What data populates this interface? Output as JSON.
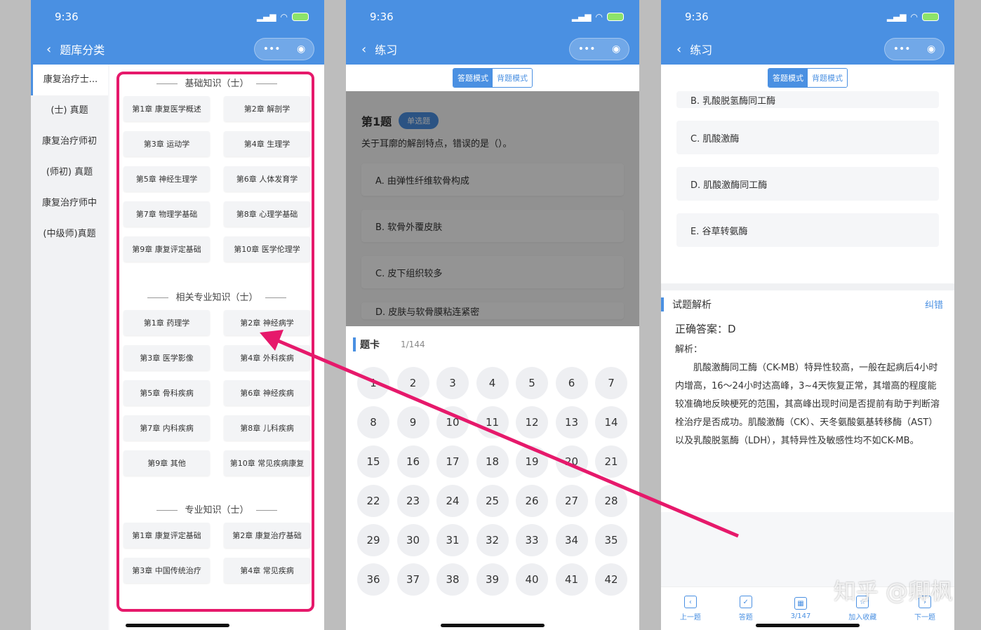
{
  "status": {
    "time": "9:36"
  },
  "phone1": {
    "nav_title": "题库分类",
    "sidebar": [
      "康复治疗士...",
      "(士) 真题",
      "康复治疗师初",
      "(师初) 真题",
      "康复治疗师中",
      "(中级师)真题"
    ],
    "sections": [
      {
        "title": "基础知识（士）",
        "chapters": [
          "第1章 康复医学概述",
          "第2章 解剖学",
          "第3章 运动学",
          "第4章 生理学",
          "第5章 神经生理学",
          "第6章 人体发育学",
          "第7章 物理学基础",
          "第8章 心理学基础",
          "第9章 康复评定基础",
          "第10章 医学伦理学"
        ]
      },
      {
        "title": "相关专业知识（士）",
        "chapters": [
          "第1章 药理学",
          "第2章 神经病学",
          "第3章 医学影像",
          "第4章 外科疾病",
          "第5章 骨科疾病",
          "第6章 神经疾病",
          "第7章 内科疾病",
          "第8章 儿科疾病",
          "第9章 其他",
          "第10章 常见疾病康复"
        ]
      },
      {
        "title": "专业知识（士）",
        "chapters": [
          "第1章 康复评定基础",
          "第2章 康复治疗基础",
          "第3章 中国传统治疗",
          "第4章 常见疾病"
        ]
      }
    ]
  },
  "phone2": {
    "nav_title": "练习",
    "mode_answer": "答题模式",
    "mode_recite": "背题模式",
    "question_no": "第1题",
    "question_type": "单选题",
    "question_text": "关于耳廓的解剖特点，错误的是（）。",
    "options": [
      "A. 由弹性纤维软骨构成",
      "B. 软骨外覆皮肤",
      "C. 皮下组织较多",
      "D. 皮肤与软骨膜粘连紧密"
    ],
    "card_title": "题卡",
    "card_count": "1/144",
    "numbers": [
      "1",
      "2",
      "3",
      "4",
      "5",
      "6",
      "7",
      "8",
      "9",
      "10",
      "11",
      "12",
      "13",
      "14",
      "15",
      "16",
      "17",
      "18",
      "19",
      "20",
      "21",
      "22",
      "23",
      "24",
      "25",
      "26",
      "27",
      "28",
      "29",
      "30",
      "31",
      "32",
      "33",
      "34",
      "35",
      "36",
      "37",
      "38",
      "39",
      "40",
      "41",
      "42"
    ]
  },
  "phone3": {
    "nav_title": "练习",
    "mode_answer": "答题模式",
    "mode_recite": "背题模式",
    "options": [
      "B. 乳酸脱氢酶同工酶",
      "C. 肌酸激酶",
      "D. 肌酸激酶同工酶",
      "E. 谷草转氨酶"
    ],
    "analysis_title": "试题解析",
    "analysis_action": "纠错",
    "answer": "正确答案：D",
    "explain_label": "解析：",
    "explain_text": "肌酸激酶同工酶（CK-MB）特异性较高，一般在起病后4小时内增高，16～24小时达高峰，3~4天恢复正常，其增高的程度能较准确地反映梗死的范围，其高峰出现时间是否提前有助于判断溶栓治疗是否成功。肌酸激酶（CK）、天冬氨酸氨基转移酶（AST）以及乳酸脱氢酶（LDH），其特异性及敏感性均不如CK-MB。",
    "bottom_nav": [
      "上一题",
      "答题",
      "3/147",
      "加入收藏",
      "下一题"
    ]
  },
  "watermark": "知乎 @卿枫",
  "colors": {
    "brand": "#4a90e2",
    "highlight": "#e6196b"
  }
}
